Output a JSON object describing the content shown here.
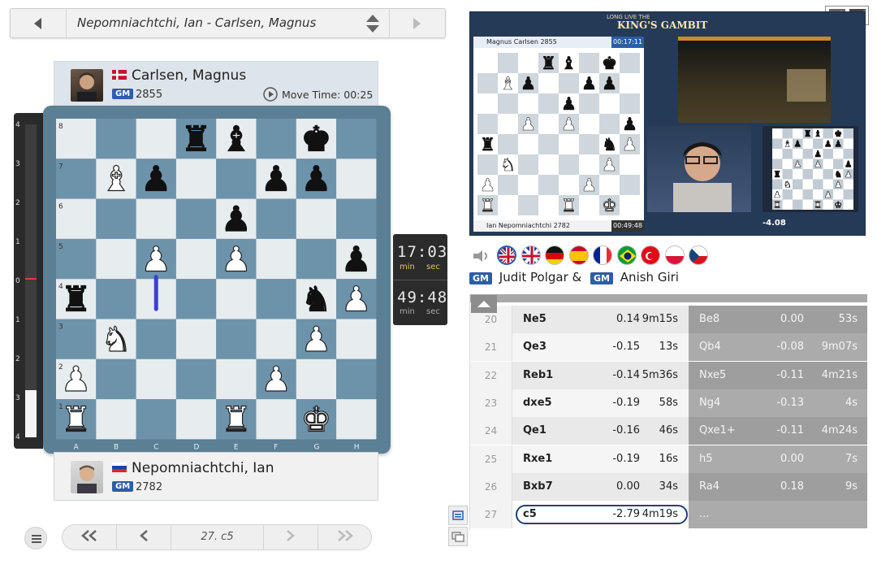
{
  "game_selector": {
    "title": "Nepomniachtchi, Ian - Carlsen, Magnus"
  },
  "top_player": {
    "name": "Carlsen, Magnus",
    "title": "GM",
    "rating": "2855",
    "move_time_label": "Move Time: 00:25",
    "flag": "denmark"
  },
  "bottom_player": {
    "name": "Nepomniachtchi, Ian",
    "title": "GM",
    "rating": "2782",
    "flag": "russia"
  },
  "board": {
    "files": [
      "A",
      "B",
      "C",
      "D",
      "E",
      "F",
      "G",
      "H"
    ],
    "ranks": [
      "8",
      "7",
      "6",
      "5",
      "4",
      "3",
      "2",
      "1"
    ],
    "pieces": [
      {
        "sq": "d8",
        "p": "br"
      },
      {
        "sq": "e8",
        "p": "bb"
      },
      {
        "sq": "g8",
        "p": "bk"
      },
      {
        "sq": "b7",
        "p": "wb"
      },
      {
        "sq": "c7",
        "p": "bp"
      },
      {
        "sq": "f7",
        "p": "bp"
      },
      {
        "sq": "g7",
        "p": "bp"
      },
      {
        "sq": "e6",
        "p": "bp"
      },
      {
        "sq": "c5",
        "p": "wp"
      },
      {
        "sq": "e5",
        "p": "wp"
      },
      {
        "sq": "h5",
        "p": "bp"
      },
      {
        "sq": "a4",
        "p": "br"
      },
      {
        "sq": "g4",
        "p": "bn"
      },
      {
        "sq": "h4",
        "p": "wp"
      },
      {
        "sq": "b3",
        "p": "wn"
      },
      {
        "sq": "g3",
        "p": "wp"
      },
      {
        "sq": "a2",
        "p": "wp"
      },
      {
        "sq": "f2",
        "p": "wp"
      },
      {
        "sq": "a1",
        "p": "wr"
      },
      {
        "sq": "e1",
        "p": "wr"
      },
      {
        "sq": "g1",
        "p": "wk"
      }
    ],
    "last_move_arrow": {
      "from": "c4",
      "to": "c5"
    }
  },
  "eval_bar": {
    "ticks": [
      "4",
      "3",
      "2",
      "1",
      "0",
      "1",
      "2",
      "3",
      "4"
    ],
    "white_share": 0.15
  },
  "clocks": {
    "top": {
      "time": "17:03",
      "unit_left": "min",
      "unit_right": "sec"
    },
    "bottom": {
      "time": "49:48",
      "unit_left": "min",
      "unit_right": "sec"
    }
  },
  "navigation": {
    "current_move": "27. c5"
  },
  "video": {
    "banner": "KING'S GAMBIT",
    "banner_top": "LONG LIVE THE",
    "mini_top_player": "Magnus Carlsen 2855",
    "mini_top_clock": "00:17:11",
    "mini_bottom_player": "Ian Nepomniachtchi 2782",
    "mini_bottom_clock": "00:49:48",
    "eval_small": "-4.08"
  },
  "languages": [
    "en-gb",
    "uk",
    "de",
    "es",
    "fr",
    "br",
    "tr",
    "pl",
    "cz"
  ],
  "commentators": [
    {
      "title": "GM",
      "name": "Judit Polgar &"
    },
    {
      "title": "GM",
      "name": "Anish Giri"
    }
  ],
  "moves": [
    {
      "n": "20",
      "w": "Ne5",
      "we": "0.14",
      "wt": "9m15s",
      "b": "Be8",
      "be": "0.00",
      "bt": "53s"
    },
    {
      "n": "21",
      "w": "Qe3",
      "we": "-0.15",
      "wt": "13s",
      "b": "Qb4",
      "be": "-0.08",
      "bt": "9m07s"
    },
    {
      "n": "22",
      "w": "Reb1",
      "we": "-0.14",
      "wt": "5m36s",
      "b": "Nxe5",
      "be": "-0.11",
      "bt": "4m21s"
    },
    {
      "n": "23",
      "w": "dxe5",
      "we": "-0.19",
      "wt": "58s",
      "b": "Ng4",
      "be": "-0.13",
      "bt": "4s"
    },
    {
      "n": "24",
      "w": "Qe1",
      "we": "-0.16",
      "wt": "46s",
      "b": "Qxe1+",
      "be": "-0.11",
      "bt": "4m24s"
    },
    {
      "n": "25",
      "w": "Rxe1",
      "we": "-0.19",
      "wt": "16s",
      "b": "h5",
      "be": "0.00",
      "bt": "7s"
    },
    {
      "n": "26",
      "w": "Bxb7",
      "we": "0.00",
      "wt": "34s",
      "b": "Ra4",
      "be": "0.18",
      "bt": "9s"
    },
    {
      "n": "27",
      "w": "c5",
      "we": "-2.79",
      "wt": "4m19s",
      "b": "...",
      "be": "",
      "bt": ""
    }
  ],
  "colors": {
    "board_light": "#e7ecef",
    "board_dark": "#6d93ab",
    "accent": "#2c5ea8",
    "arrow": "#3a3fd6"
  }
}
